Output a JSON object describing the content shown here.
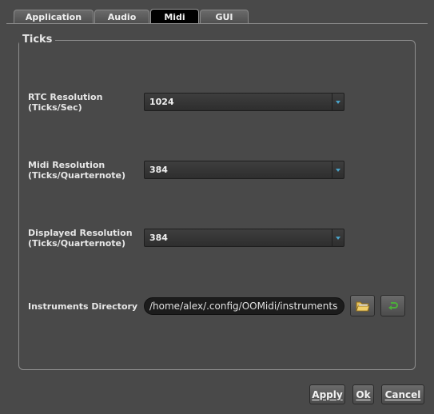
{
  "tabs": [
    {
      "label": "Application"
    },
    {
      "label": "Audio"
    },
    {
      "label": "Midi"
    },
    {
      "label": "GUI"
    }
  ],
  "group": {
    "title": "Ticks"
  },
  "rtc": {
    "label": "RTC Resolution\n(Ticks/Sec)",
    "value": "1024"
  },
  "midi_res": {
    "label": "Midi Resolution\n(Ticks/Quarternote)",
    "value": "384"
  },
  "display_res": {
    "label": "Displayed Resolution\n(Ticks/Quarternote)",
    "value": "384"
  },
  "instruments": {
    "label": "Instruments Directory",
    "value": "/home/alex/.config/OOMidi/instruments"
  },
  "buttons": {
    "apply": "Apply",
    "ok": "Ok",
    "cancel": "Cancel"
  },
  "colors": {
    "background": "#494949",
    "combo_arrow": "#4aa3c8",
    "reset_icon": "#4caf3a"
  }
}
